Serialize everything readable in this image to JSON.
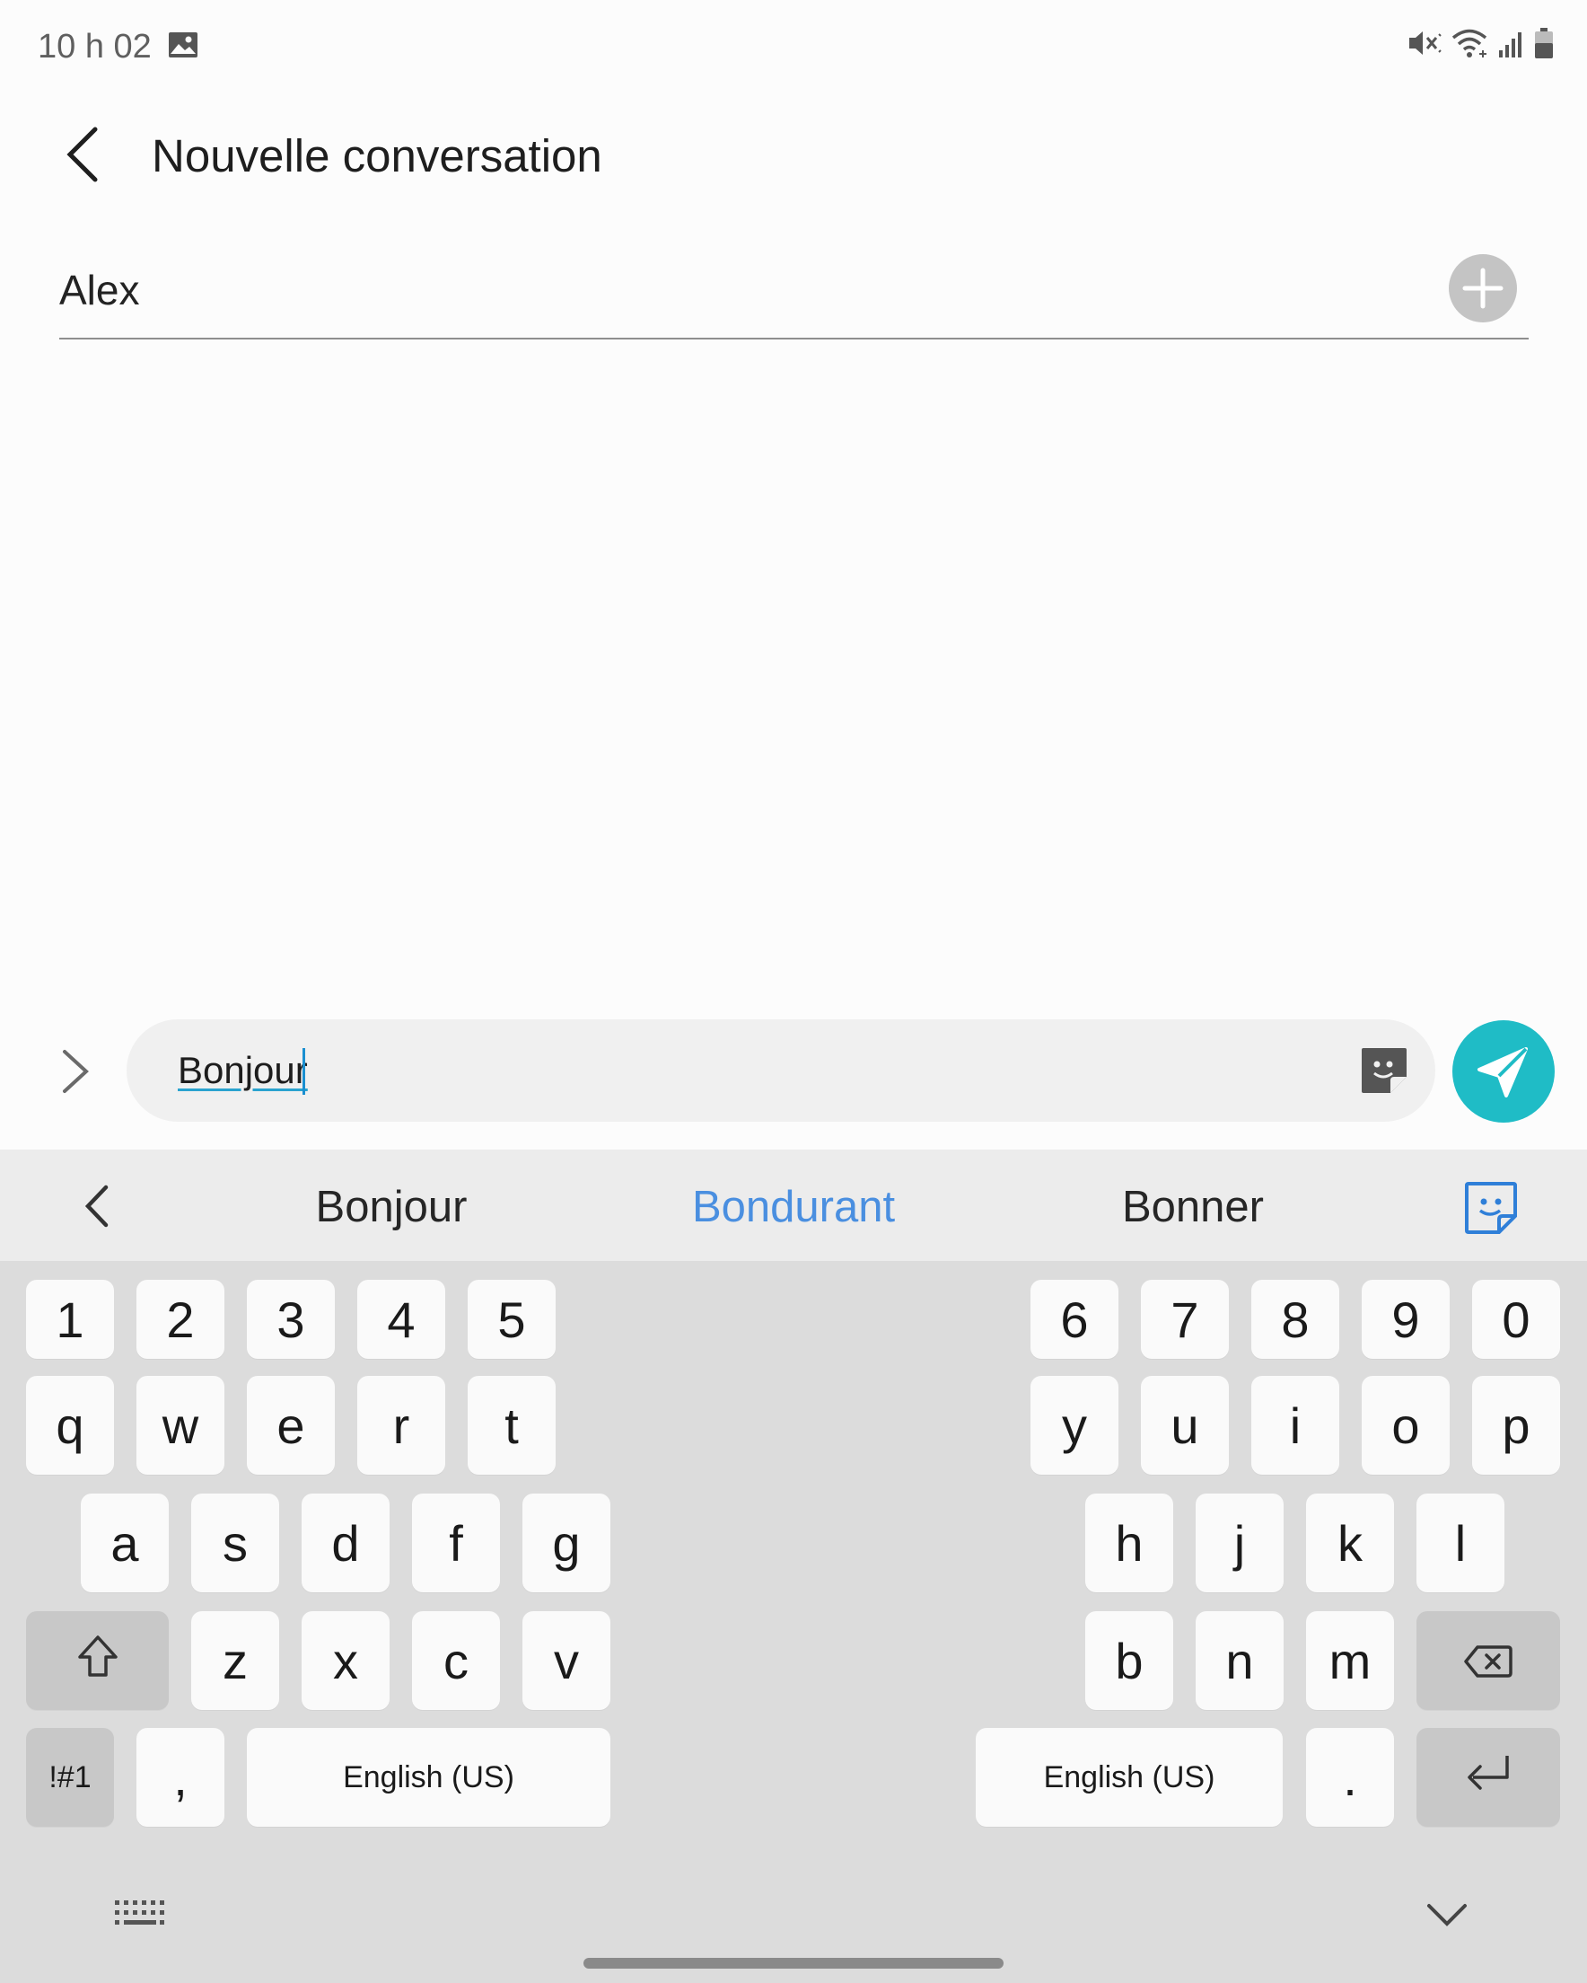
{
  "status_bar": {
    "time": "10 h 02",
    "icons": [
      "gallery-icon",
      "mute-icon",
      "wifi-icon",
      "signal-icon",
      "battery-icon"
    ]
  },
  "header": {
    "back_icon": "chevron-left-icon",
    "title": "Nouvelle conversation"
  },
  "recipient": {
    "value": "Alex",
    "add_icon": "plus-icon"
  },
  "composer": {
    "expand_icon": "chevron-right-icon",
    "message": "Bonjour",
    "sticker_icon": "sticker-icon",
    "send_icon": "send-icon",
    "send_color": "#1fbcc6"
  },
  "keyboard": {
    "suggestions": [
      {
        "text": "Bonjour",
        "color": "#262626"
      },
      {
        "text": "Bondurant",
        "color": "#4a8fe0"
      },
      {
        "text": "Bonner",
        "color": "#262626"
      }
    ],
    "rows": {
      "numbers_left": [
        "1",
        "2",
        "3",
        "4",
        "5"
      ],
      "numbers_right": [
        "6",
        "7",
        "8",
        "9",
        "0"
      ],
      "top_left": [
        "q",
        "w",
        "e",
        "r",
        "t"
      ],
      "top_right": [
        "y",
        "u",
        "i",
        "o",
        "p"
      ],
      "home_left": [
        "a",
        "s",
        "d",
        "f",
        "g"
      ],
      "home_right": [
        "h",
        "j",
        "k",
        "l"
      ],
      "bottom_left": [
        "z",
        "x",
        "c",
        "v"
      ],
      "bottom_right": [
        "b",
        "n",
        "m"
      ]
    },
    "symbols_key": "!#1",
    "comma_key": ",",
    "period_key": ".",
    "space_left_label": "English (US)",
    "space_right_label": "English (US)"
  }
}
